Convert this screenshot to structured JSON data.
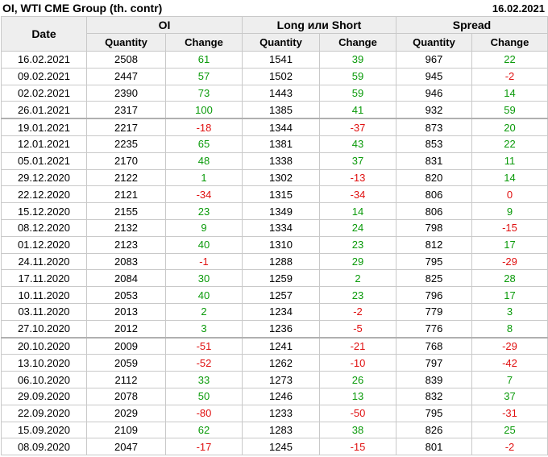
{
  "header": {
    "title": "OI, WTI CME Group (th. contr)",
    "date": "16.02.2021"
  },
  "columns": {
    "date": "Date",
    "groups": [
      "OI",
      "Long или Short",
      "Spread"
    ],
    "quantity": "Quantity",
    "change": "Change"
  },
  "colors": {
    "positive": "#0a9a0a",
    "negative": "#e01010"
  },
  "rows": [
    {
      "date": "16.02.2021",
      "oi_q": "2508",
      "oi_c": "61",
      "ls_q": "1541",
      "ls_c": "39",
      "sp_q": "967",
      "sp_c": "22"
    },
    {
      "date": "09.02.2021",
      "oi_q": "2447",
      "oi_c": "57",
      "ls_q": "1502",
      "ls_c": "59",
      "sp_q": "945",
      "sp_c": "-2"
    },
    {
      "date": "02.02.2021",
      "oi_q": "2390",
      "oi_c": "73",
      "ls_q": "1443",
      "ls_c": "59",
      "sp_q": "946",
      "sp_c": "14"
    },
    {
      "date": "26.01.2021",
      "oi_q": "2317",
      "oi_c": "100",
      "ls_q": "1385",
      "ls_c": "41",
      "sp_q": "932",
      "sp_c": "59"
    },
    {
      "date": "19.01.2021",
      "oi_q": "2217",
      "oi_c": "-18",
      "ls_q": "1344",
      "ls_c": "-37",
      "sp_q": "873",
      "sp_c": "20",
      "sep": true
    },
    {
      "date": "12.01.2021",
      "oi_q": "2235",
      "oi_c": "65",
      "ls_q": "1381",
      "ls_c": "43",
      "sp_q": "853",
      "sp_c": "22"
    },
    {
      "date": "05.01.2021",
      "oi_q": "2170",
      "oi_c": "48",
      "ls_q": "1338",
      "ls_c": "37",
      "sp_q": "831",
      "sp_c": "11"
    },
    {
      "date": "29.12.2020",
      "oi_q": "2122",
      "oi_c": "1",
      "ls_q": "1302",
      "ls_c": "-13",
      "sp_q": "820",
      "sp_c": "14"
    },
    {
      "date": "22.12.2020",
      "oi_q": "2121",
      "oi_c": "-34",
      "ls_q": "1315",
      "ls_c": "-34",
      "sp_q": "806",
      "sp_c": "0"
    },
    {
      "date": "15.12.2020",
      "oi_q": "2155",
      "oi_c": "23",
      "ls_q": "1349",
      "ls_c": "14",
      "sp_q": "806",
      "sp_c": "9"
    },
    {
      "date": "08.12.2020",
      "oi_q": "2132",
      "oi_c": "9",
      "ls_q": "1334",
      "ls_c": "24",
      "sp_q": "798",
      "sp_c": "-15"
    },
    {
      "date": "01.12.2020",
      "oi_q": "2123",
      "oi_c": "40",
      "ls_q": "1310",
      "ls_c": "23",
      "sp_q": "812",
      "sp_c": "17"
    },
    {
      "date": "24.11.2020",
      "oi_q": "2083",
      "oi_c": "-1",
      "ls_q": "1288",
      "ls_c": "29",
      "sp_q": "795",
      "sp_c": "-29"
    },
    {
      "date": "17.11.2020",
      "oi_q": "2084",
      "oi_c": "30",
      "ls_q": "1259",
      "ls_c": "2",
      "sp_q": "825",
      "sp_c": "28"
    },
    {
      "date": "10.11.2020",
      "oi_q": "2053",
      "oi_c": "40",
      "ls_q": "1257",
      "ls_c": "23",
      "sp_q": "796",
      "sp_c": "17"
    },
    {
      "date": "03.11.2020",
      "oi_q": "2013",
      "oi_c": "2",
      "ls_q": "1234",
      "ls_c": "-2",
      "sp_q": "779",
      "sp_c": "3"
    },
    {
      "date": "27.10.2020",
      "oi_q": "2012",
      "oi_c": "3",
      "ls_q": "1236",
      "ls_c": "-5",
      "sp_q": "776",
      "sp_c": "8"
    },
    {
      "date": "20.10.2020",
      "oi_q": "2009",
      "oi_c": "-51",
      "ls_q": "1241",
      "ls_c": "-21",
      "sp_q": "768",
      "sp_c": "-29",
      "sep": true
    },
    {
      "date": "13.10.2020",
      "oi_q": "2059",
      "oi_c": "-52",
      "ls_q": "1262",
      "ls_c": "-10",
      "sp_q": "797",
      "sp_c": "-42"
    },
    {
      "date": "06.10.2020",
      "oi_q": "2112",
      "oi_c": "33",
      "ls_q": "1273",
      "ls_c": "26",
      "sp_q": "839",
      "sp_c": "7"
    },
    {
      "date": "29.09.2020",
      "oi_q": "2078",
      "oi_c": "50",
      "ls_q": "1246",
      "ls_c": "13",
      "sp_q": "832",
      "sp_c": "37"
    },
    {
      "date": "22.09.2020",
      "oi_q": "2029",
      "oi_c": "-80",
      "ls_q": "1233",
      "ls_c": "-50",
      "sp_q": "795",
      "sp_c": "-31"
    },
    {
      "date": "15.09.2020",
      "oi_q": "2109",
      "oi_c": "62",
      "ls_q": "1283",
      "ls_c": "38",
      "sp_q": "826",
      "sp_c": "25"
    },
    {
      "date": "08.09.2020",
      "oi_q": "2047",
      "oi_c": "-17",
      "ls_q": "1245",
      "ls_c": "-15",
      "sp_q": "801",
      "sp_c": "-2"
    }
  ]
}
